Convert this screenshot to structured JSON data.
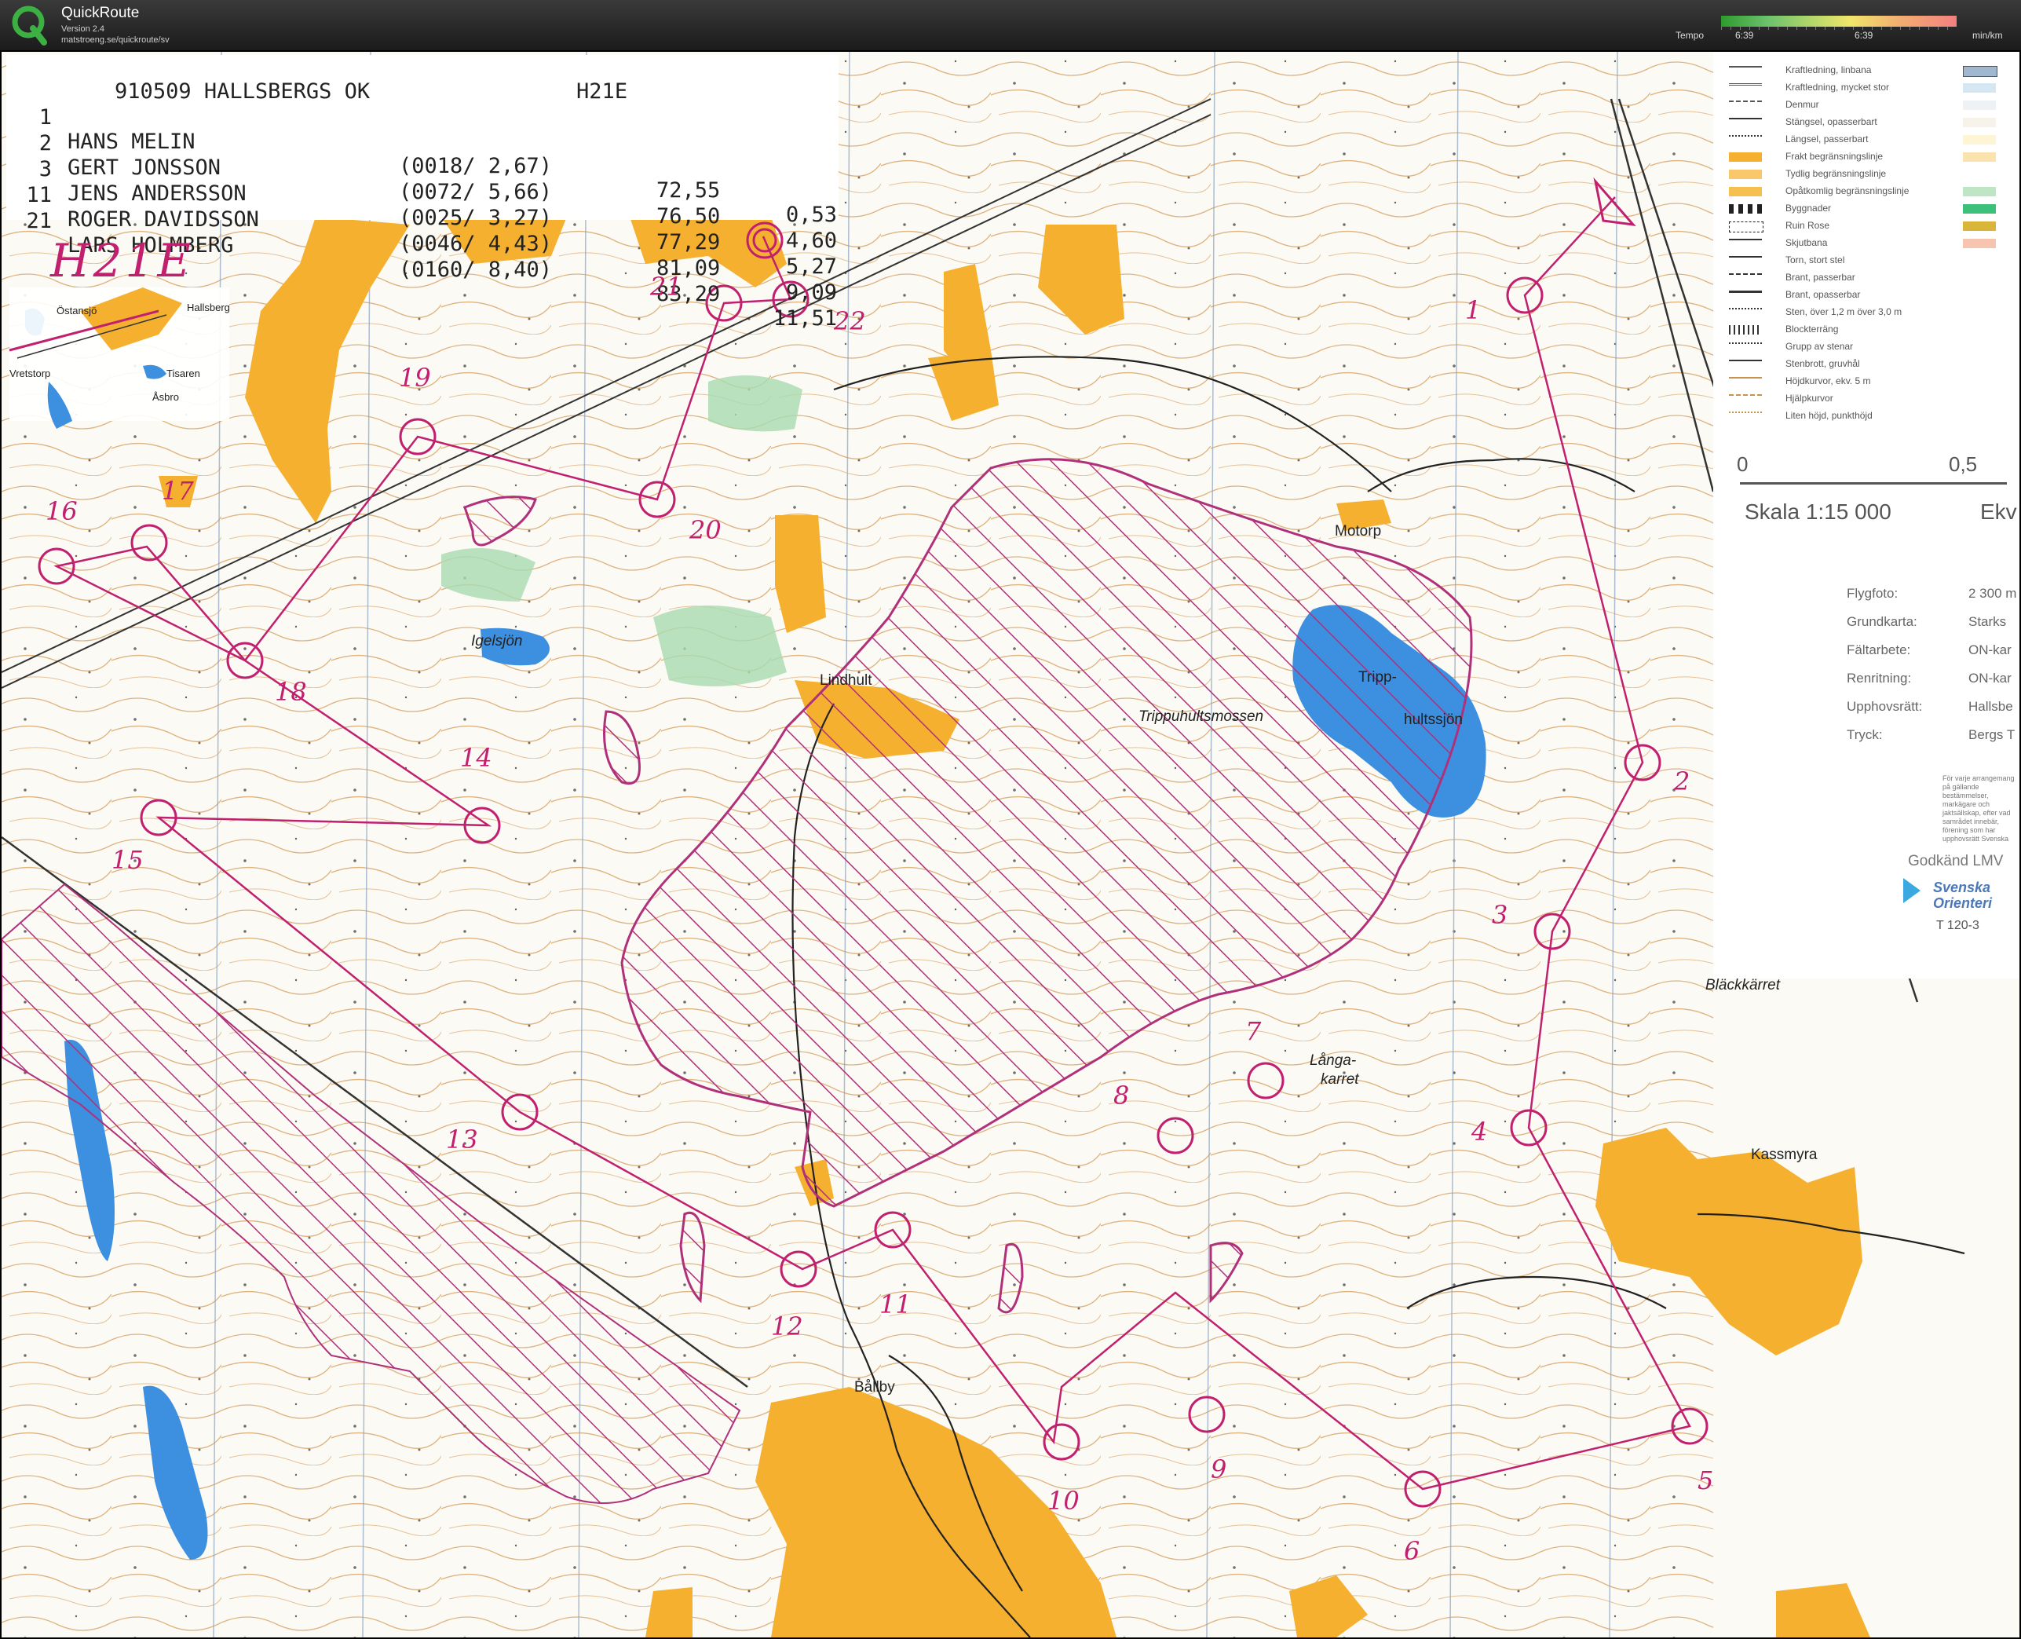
{
  "app": {
    "name": "QuickRoute",
    "version": "Version 2.4",
    "url": "matstroeng.se/quickroute/sv",
    "tempo_label": "Tempo",
    "tempo_left": "6:39",
    "tempo_mid": "6:39",
    "tempo_unit": "min/km"
  },
  "results": {
    "header_event": "910509 HALLSBERGS OK",
    "header_class": "H21E",
    "rows": [
      {
        "rank": "1",
        "name": "HANS MELIN",
        "split": "(0018/ 2,67)",
        "time": "72,55",
        "behind": "0,53"
      },
      {
        "rank": "2",
        "name": "GERT JONSSON",
        "split": "(0072/ 5,66)",
        "time": "76,50",
        "behind": "4,60"
      },
      {
        "rank": "3",
        "name": "JENS ANDERSSON",
        "split": "(0025/ 3,27)",
        "time": "77,29",
        "behind": "5,27"
      },
      {
        "rank": "11",
        "name": "ROGER DAVIDSSON",
        "split": "(0046/ 4,43)",
        "time": "81,09",
        "behind": "9,09"
      },
      {
        "rank": "21",
        "name": "LARS HOLMBERG",
        "split": "(0160/ 8,40)",
        "time": "83,29",
        "behind": "11,51"
      }
    ]
  },
  "map": {
    "class_label": "H21E",
    "overview": {
      "labels": [
        "Östansjö",
        "Hallsberg",
        "Vretstorp",
        "Tisaren",
        "Åsbro"
      ]
    },
    "places": {
      "motorp": "Motorp",
      "lindhult": "Lindhult",
      "igelsjon": "Igelsjön",
      "trippmossen": "Trippuhultsmossen",
      "tripp1": "Tripp-",
      "tripp2": "hultssjön",
      "blackkarret": "Bläckkärret",
      "langa1": "Långa-",
      "langa2": "karret",
      "kassmyra": "Kassmyra",
      "ballby": "Bållby"
    },
    "control_numbers": [
      "1",
      "2",
      "3",
      "4",
      "5",
      "6",
      "7",
      "8",
      "9",
      "10",
      "11",
      "12",
      "13",
      "14",
      "15",
      "16",
      "17",
      "18",
      "19",
      "20",
      "21",
      "22"
    ]
  },
  "legend": {
    "items": [
      "Kraftledning, linbana",
      "Kraftledning, mycket stor",
      "Denmur",
      "Stängsel, opasserbart",
      "Längsel, passerbart",
      "Frakt begränsningslinje",
      "Tydlig begränsningslinje",
      "Opåtkomlig begränsningslinje",
      "Byggnader",
      "Ruin Rose",
      "Skjutbana",
      "Torn, stort stel",
      "Brant, passerbar",
      "Brant, opasserbar",
      "Sten, över 1,2 m över 3,0 m",
      "Blockterräng",
      "Grupp av stenar",
      "Stenbrott, gruvhål",
      "Höjdkurvor, ekv. 5 m",
      "Hjälpkurvor",
      "Liten höjd, punkthöjd"
    ],
    "scale_zero": "0",
    "scale_half": "0,5",
    "scale_text": "Skala 1:15 000",
    "scale_ekv": "Ekv",
    "info": [
      {
        "k": "Flygfoto:",
        "v": "2 300 m"
      },
      {
        "k": "Grundkarta:",
        "v": "Starks"
      },
      {
        "k": "Fältarbete:",
        "v": "ON-kar"
      },
      {
        "k": "Renritning:",
        "v": "ON-kar"
      },
      {
        "k": "Upphovsrätt:",
        "v": "Hallsbe"
      },
      {
        "k": "Tryck:",
        "v": "Bergs T"
      }
    ],
    "notice": "För varje arrangemang på gällande bestämmelser, markägare och jaktsällskap, efter vad samrådet innebär, förening som har upphovsrätt Svenska",
    "approved": "Godkänd LMV",
    "sof_line1": "Svenska",
    "sof_line2": "Orienteri",
    "tcode": "T 120-3"
  },
  "colors": {
    "course": "#c0206e",
    "open_land": "#f5b030",
    "water": "#3d8fe0",
    "green": "#9fd8a6",
    "contour": "#c9914e"
  }
}
